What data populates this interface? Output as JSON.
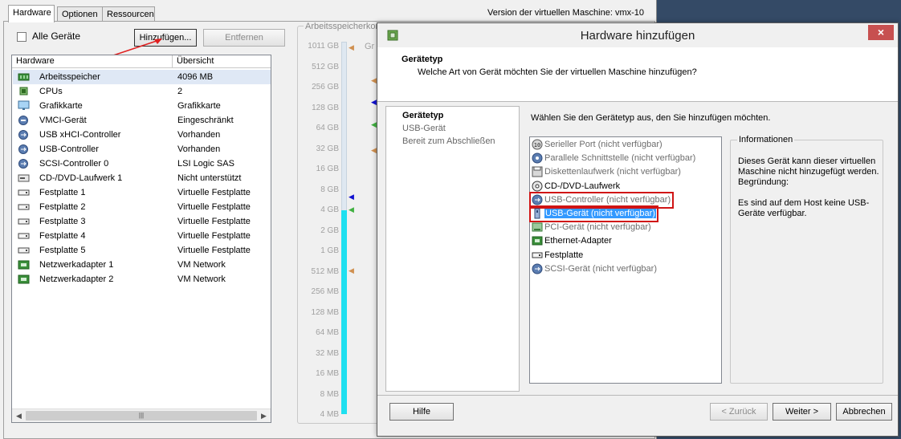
{
  "bg": {
    "tabs": [
      "Hardware",
      "Optionen",
      "Ressourcen"
    ],
    "vm_version": "Version der virtuellen Maschine: vmx-10",
    "all_devices": "Alle Geräte",
    "add_button": "Hinzufügen...",
    "remove_button": "Entfernen",
    "columns": [
      "Hardware",
      "Übersicht"
    ],
    "rows": [
      {
        "name": "Arbeitsspeicher",
        "summary": "4096 MB",
        "icon": "memory-icon"
      },
      {
        "name": "CPUs",
        "summary": "2",
        "icon": "cpu-icon"
      },
      {
        "name": "Grafikkarte",
        "summary": "Grafikkarte",
        "icon": "monitor-icon"
      },
      {
        "name": "VMCI-Gerät",
        "summary": "Eingeschränkt",
        "icon": "vmci-icon"
      },
      {
        "name": "USB xHCI-Controller",
        "summary": "Vorhanden",
        "icon": "usb-icon"
      },
      {
        "name": "USB-Controller",
        "summary": "Vorhanden",
        "icon": "usb-icon"
      },
      {
        "name": "SCSI-Controller 0",
        "summary": "LSI Logic SAS",
        "icon": "scsi-icon"
      },
      {
        "name": "CD-/DVD-Laufwerk 1",
        "summary": "Nicht unterstützt",
        "icon": "cd-icon"
      },
      {
        "name": "Festplatte 1",
        "summary": "Virtuelle Festplatte",
        "icon": "disk-icon"
      },
      {
        "name": "Festplatte 2",
        "summary": "Virtuelle Festplatte",
        "icon": "disk-icon"
      },
      {
        "name": "Festplatte 3",
        "summary": "Virtuelle Festplatte",
        "icon": "disk-icon"
      },
      {
        "name": "Festplatte 4",
        "summary": "Virtuelle Festplatte",
        "icon": "disk-icon"
      },
      {
        "name": "Festplatte 5",
        "summary": "Virtuelle Festplatte",
        "icon": "disk-icon"
      },
      {
        "name": "Netzwerkadapter 1",
        "summary": "VM Network",
        "icon": "nic-icon"
      },
      {
        "name": "Netzwerkadapter 2",
        "summary": "VM Network",
        "icon": "nic-icon"
      }
    ],
    "memory_title": "Arbeitsspeicherkon",
    "memory_title_tail": "Gr",
    "memory_scale": [
      "1011 GB",
      "512 GB",
      "256 GB",
      "128 GB",
      "64 GB",
      "32 GB",
      "16 GB",
      "8 GB",
      "4 GB",
      "2 GB",
      "1 GB",
      "512 MB",
      "256 MB",
      "128 MB",
      "64 MB",
      "32 MB",
      "16 MB",
      "8 MB",
      "4 MB"
    ]
  },
  "dialog": {
    "title": "Hardware hinzufügen",
    "close_glyph": "×",
    "header_title": "Gerätetyp",
    "header_sub": "Welche Art von Gerät möchten Sie der virtuellen Maschine hinzufügen?",
    "steps": [
      "Gerätetyp",
      "USB-Gerät",
      "Bereit zum Abschließen"
    ],
    "instruction": "Wählen Sie den Gerätetyp aus, den Sie hinzufügen möchten.",
    "devices": [
      {
        "label": "Serieller Port (nicht verfügbar)",
        "available": false,
        "icon": "serial-port-icon"
      },
      {
        "label": "Parallele Schnittstelle (nicht verfügbar)",
        "available": false,
        "icon": "parallel-port-icon"
      },
      {
        "label": "Diskettenlaufwerk (nicht verfügbar)",
        "available": false,
        "icon": "floppy-icon"
      },
      {
        "label": "CD-/DVD-Laufwerk",
        "available": true,
        "icon": "cd-icon"
      },
      {
        "label": "USB-Controller (nicht verfügbar)",
        "available": false,
        "icon": "usb-controller-icon"
      },
      {
        "label": "USB-Gerät (nicht verfügbar)",
        "available": false,
        "icon": "usb-device-icon"
      },
      {
        "label": "PCI-Gerät (nicht verfügbar)",
        "available": false,
        "icon": "pci-icon"
      },
      {
        "label": "Ethernet-Adapter",
        "available": true,
        "icon": "ethernet-icon"
      },
      {
        "label": "Festplatte",
        "available": true,
        "icon": "hard-disk-icon"
      },
      {
        "label": "SCSI-Gerät (nicht verfügbar)",
        "available": false,
        "icon": "scsi-device-icon"
      }
    ],
    "info_caption": "Informationen",
    "info_text": "Dieses Gerät kann dieser virtuellen Maschine nicht hinzugefügt werden. Begründung:\n\nEs sind auf dem Host keine USB-Geräte verfügbar.",
    "buttons": {
      "help": "Hilfe",
      "back": "< Zurück",
      "next": "Weiter >",
      "cancel": "Abbrechen"
    }
  },
  "colors": {
    "selection": "#3399ff",
    "highlight_box": "#d01414",
    "memory_fill": "#1ee0f0",
    "close": "#c75050"
  }
}
